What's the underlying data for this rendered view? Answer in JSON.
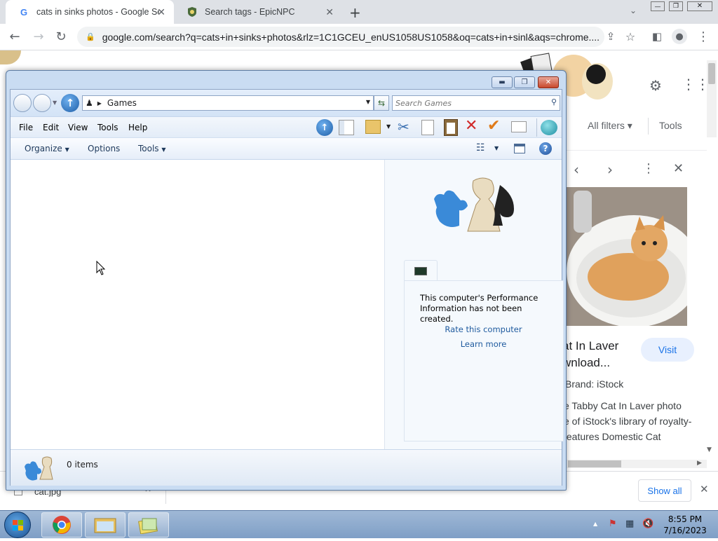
{
  "browser": {
    "tabs": [
      {
        "title": "cats in sinks photos - Google Search",
        "favicon": "G"
      },
      {
        "title": "Search tags - EpicNPC",
        "favicon": "epicnpc-icon"
      }
    ],
    "new_tab_label": "+",
    "url": "google.com/search?q=cats+in+sinks+photos&rlz=1C1GCEU_enUS1058US1058&oq=cats+in+sinl&aqs=chrome...."
  },
  "google": {
    "all_filters": "All filters",
    "tools": "Tools",
    "result_title_line1": "at In Laver",
    "result_title_line2": "wnload...",
    "visit_label": "Visit",
    "brand": "Brand: iStock",
    "desc_line1": "e Tabby Cat In Laver photo",
    "desc_line2": "e of iStock's library of royalty-",
    "desc_line3": "features Domestic Cat"
  },
  "downloads": {
    "file": "cat.jpg",
    "show_all": "Show all"
  },
  "explorer": {
    "breadcrumb": "Games",
    "search_placeholder": "Search Games",
    "menu": [
      "File",
      "Edit",
      "View",
      "Tools",
      "Help"
    ],
    "commands": {
      "organize": "Organize",
      "options": "Options",
      "tools": "Tools"
    },
    "preview_text": "This computer's Performance Information has not been created.",
    "rate_link": "Rate this computer",
    "learn_link": "Learn more",
    "item_count": "0 items"
  },
  "taskbar": {
    "time": "8:55 PM",
    "date": "7/16/2023"
  },
  "colors": {
    "accent": "#1a73e8",
    "win_frame": "#c9dcf2",
    "link": "#1e5a9e"
  }
}
